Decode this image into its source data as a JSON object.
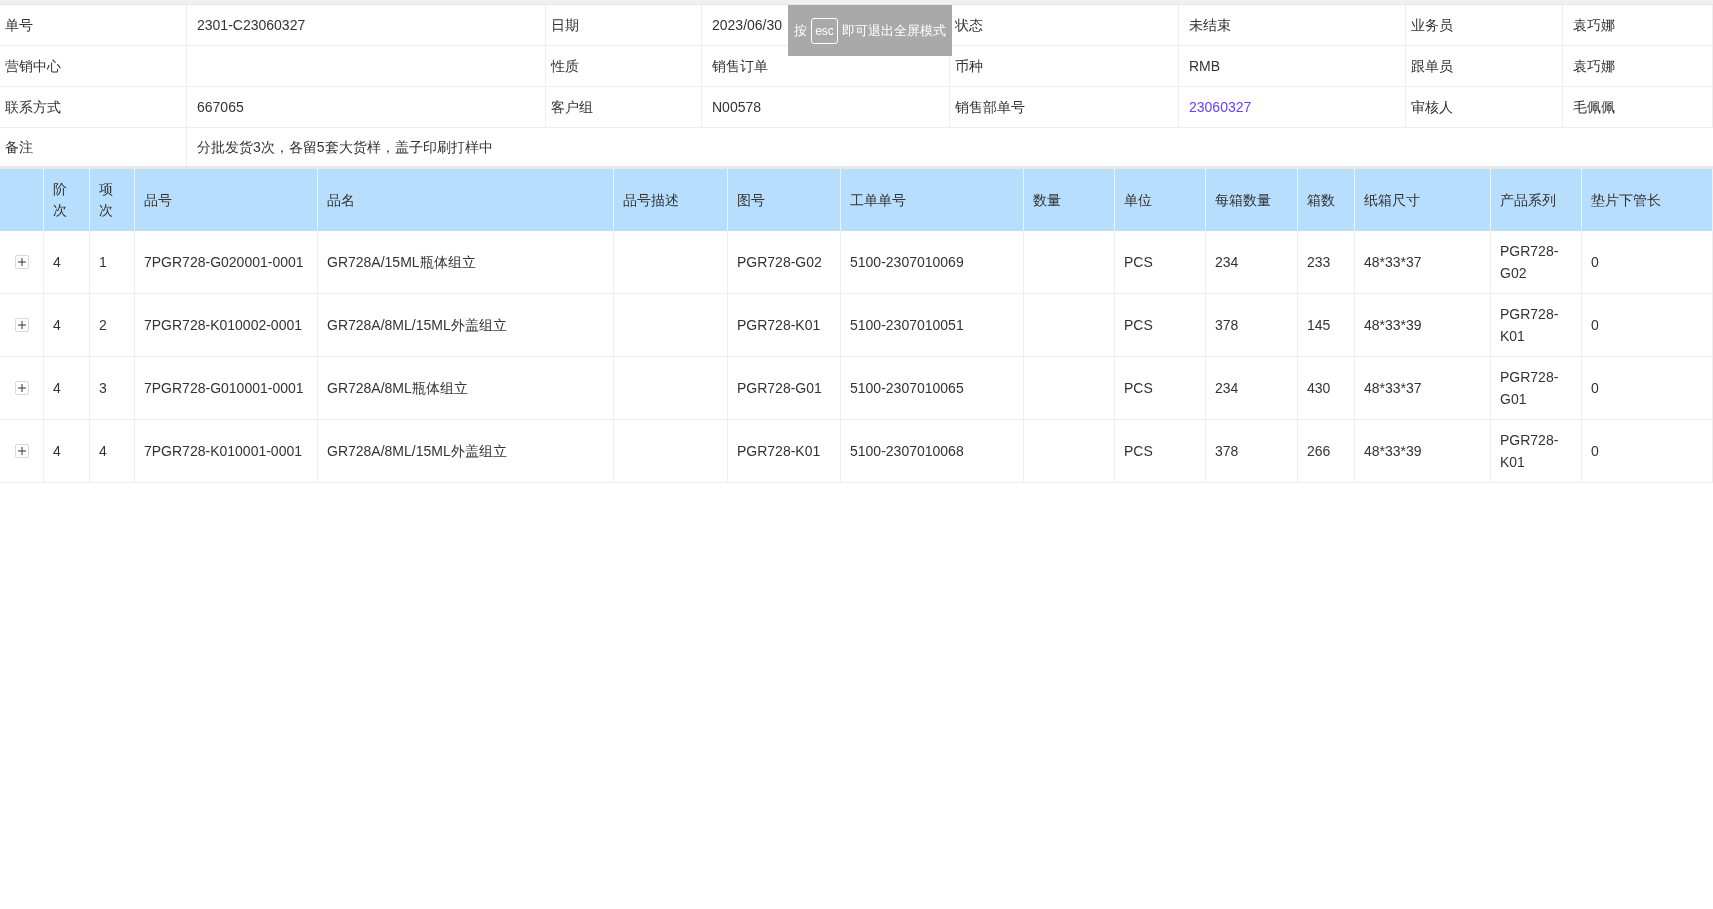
{
  "info_table": {
    "rows": [
      [
        {
          "label": "单号",
          "value": "2301-C23060327"
        },
        {
          "label": "日期",
          "value": "2023/06/30"
        },
        {
          "label": "状态",
          "value": "未结束"
        },
        {
          "label": "业务员",
          "value": "袁巧娜"
        }
      ],
      [
        {
          "label": "营销中心"
        },
        {
          "label": "性质",
          "value": "销售订单"
        },
        {
          "label": "币种",
          "value": "RMB"
        },
        {
          "label": "跟单员",
          "value": "袁巧娜"
        }
      ],
      [
        {
          "label": "联系方式",
          "value": "667065"
        },
        {
          "label": "客户组",
          "value": "N00578"
        },
        {
          "label": "销售部单号",
          "value": "23060327",
          "kind": "link"
        },
        {
          "label": "审核人",
          "value": "毛佩佩"
        }
      ]
    ],
    "remark": {
      "label": "备注",
      "value": "分批发货3次，各留5套大货样，盖子印刷打样中"
    }
  },
  "table": {
    "columns": [
      "阶次",
      "项次",
      "品号",
      "品名",
      "品号描述",
      "图号",
      "工单单号",
      "数量",
      "单位",
      "每箱数量",
      "箱数",
      "纸箱尺寸",
      "产品系列",
      "垫片下管长"
    ],
    "rows": [
      {
        "expanded": false,
        "cells": [
          "4",
          "1",
          "7PGR728-G020001-0001",
          "GR728A/15ML瓶体组立",
          "",
          "PGR728-G02",
          "5100-2307010069",
          "",
          "PCS",
          "234",
          "233",
          "48*33*37",
          "PGR728-G02",
          "0"
        ]
      },
      {
        "expanded": false,
        "cells": [
          "4",
          "2",
          "7PGR728-K010002-0001",
          "GR728A/8ML/15ML外盖组立",
          "",
          "PGR728-K01",
          "5100-2307010051",
          "",
          "PCS",
          "378",
          "145",
          "48*33*39",
          "PGR728-K01",
          "0"
        ]
      },
      {
        "expanded": false,
        "cells": [
          "4",
          "3",
          "7PGR728-G010001-0001",
          "GR728A/8ML瓶体组立",
          "",
          "PGR728-G01",
          "5100-2307010065",
          "",
          "PCS",
          "234",
          "430",
          "48*33*37",
          "PGR728-G01",
          "0"
        ]
      },
      {
        "expanded": false,
        "cells": [
          "4",
          "4",
          "7PGR728-K010001-0001",
          "GR728A/8ML/15ML外盖组立",
          "",
          "PGR728-K01",
          "5100-2307010068",
          "",
          "PCS",
          "378",
          "266",
          "48*33*39",
          "PGR728-K01",
          "0"
        ]
      }
    ]
  },
  "fullscreen_toast": {
    "text_before": "按",
    "key": "esc",
    "text_after": "即可退出全屏模式"
  }
}
